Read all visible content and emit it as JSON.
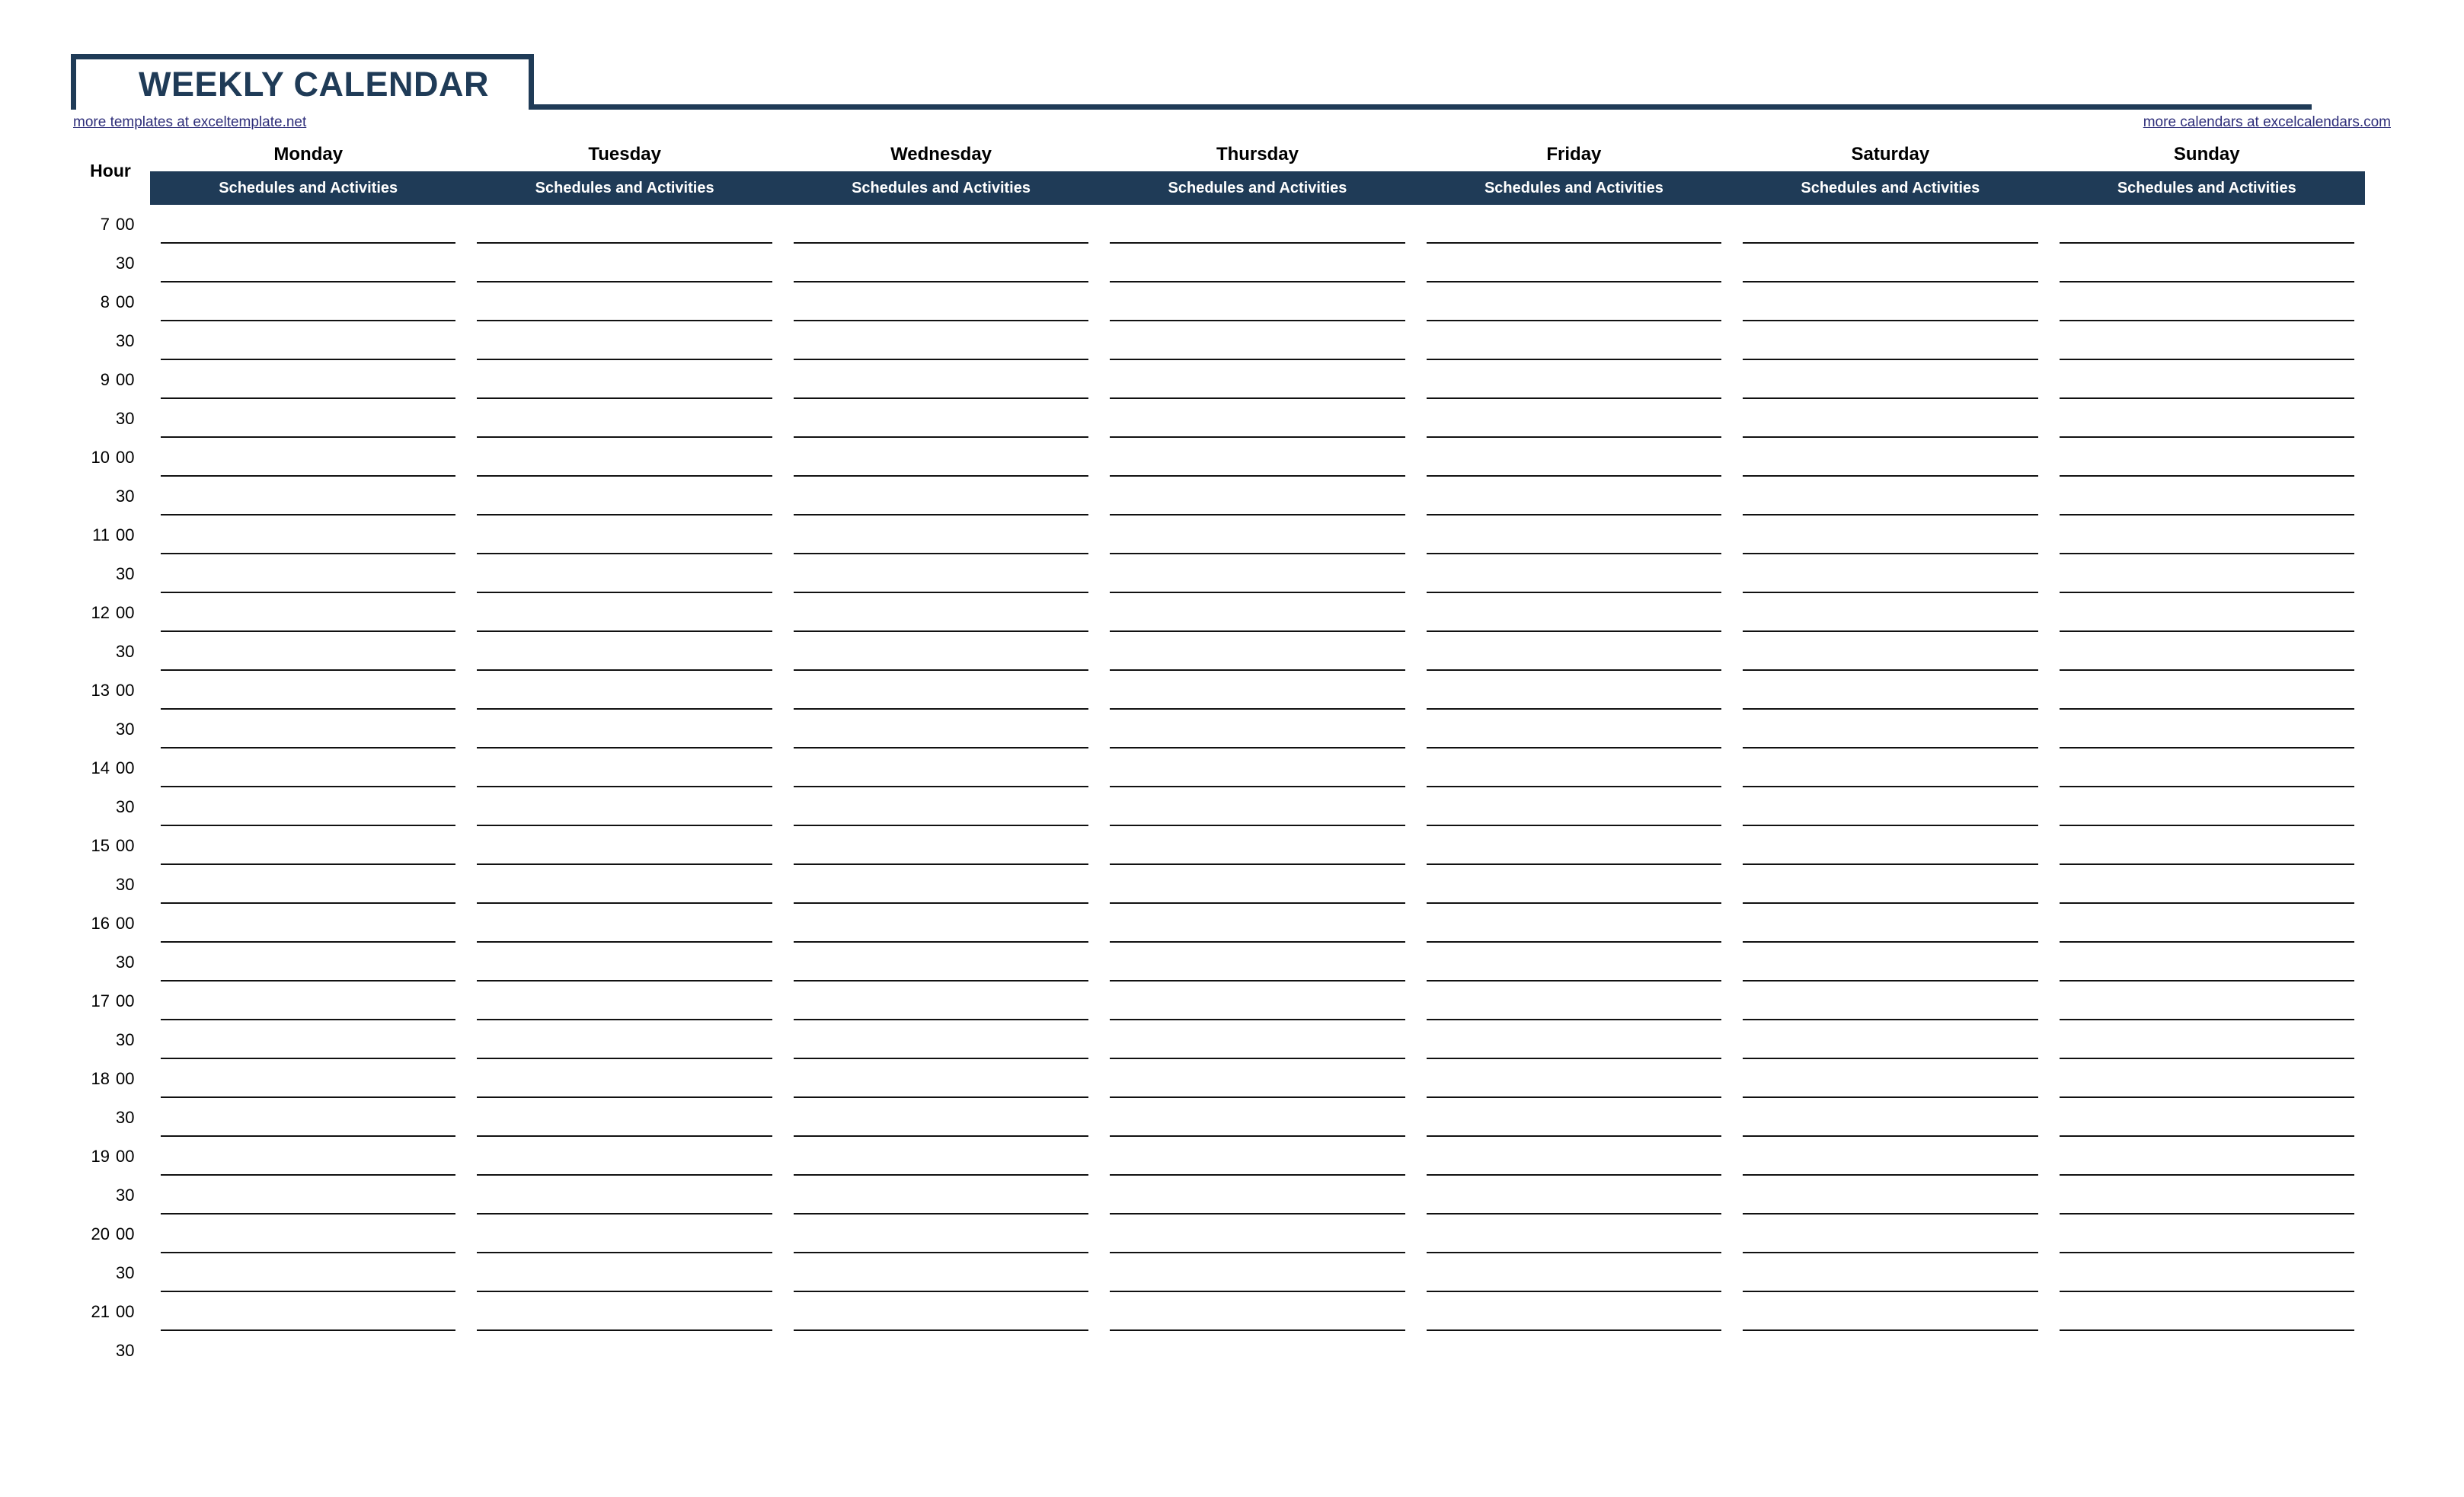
{
  "document": {
    "title": "WEEKLY CALENDAR"
  },
  "links": {
    "left": "more templates at exceltemplate.net",
    "right": "more calendars at excelcalendars.com"
  },
  "table": {
    "hour_column_header": "Hour",
    "subheader_label": "Schedules and Activities",
    "days": [
      "Monday",
      "Tuesday",
      "Wednesday",
      "Thursday",
      "Friday",
      "Saturday",
      "Sunday"
    ],
    "time_slots": [
      {
        "hour": "7",
        "minute": "00"
      },
      {
        "hour": "",
        "minute": "30"
      },
      {
        "hour": "8",
        "minute": "00"
      },
      {
        "hour": "",
        "minute": "30"
      },
      {
        "hour": "9",
        "minute": "00"
      },
      {
        "hour": "",
        "minute": "30"
      },
      {
        "hour": "10",
        "minute": "00"
      },
      {
        "hour": "",
        "minute": "30"
      },
      {
        "hour": "11",
        "minute": "00"
      },
      {
        "hour": "",
        "minute": "30"
      },
      {
        "hour": "12",
        "minute": "00"
      },
      {
        "hour": "",
        "minute": "30"
      },
      {
        "hour": "13",
        "minute": "00"
      },
      {
        "hour": "",
        "minute": "30"
      },
      {
        "hour": "14",
        "minute": "00"
      },
      {
        "hour": "",
        "minute": "30"
      },
      {
        "hour": "15",
        "minute": "00"
      },
      {
        "hour": "",
        "minute": "30"
      },
      {
        "hour": "16",
        "minute": "00"
      },
      {
        "hour": "",
        "minute": "30"
      },
      {
        "hour": "17",
        "minute": "00"
      },
      {
        "hour": "",
        "minute": "30"
      },
      {
        "hour": "18",
        "minute": "00"
      },
      {
        "hour": "",
        "minute": "30"
      },
      {
        "hour": "19",
        "minute": "00"
      },
      {
        "hour": "",
        "minute": "30"
      },
      {
        "hour": "20",
        "minute": "00"
      },
      {
        "hour": "",
        "minute": "30"
      },
      {
        "hour": "21",
        "minute": "00"
      },
      {
        "hour": "",
        "minute": "30"
      }
    ],
    "entries": [
      [
        "",
        "",
        "",
        "",
        "",
        "",
        ""
      ],
      [
        "",
        "",
        "",
        "",
        "",
        "",
        ""
      ],
      [
        "",
        "",
        "",
        "",
        "",
        "",
        ""
      ],
      [
        "",
        "",
        "",
        "",
        "",
        "",
        ""
      ],
      [
        "",
        "",
        "",
        "",
        "",
        "",
        ""
      ],
      [
        "",
        "",
        "",
        "",
        "",
        "",
        ""
      ],
      [
        "",
        "",
        "",
        "",
        "",
        "",
        ""
      ],
      [
        "",
        "",
        "",
        "",
        "",
        "",
        ""
      ],
      [
        "",
        "",
        "",
        "",
        "",
        "",
        ""
      ],
      [
        "",
        "",
        "",
        "",
        "",
        "",
        ""
      ],
      [
        "",
        "",
        "",
        "",
        "",
        "",
        ""
      ],
      [
        "",
        "",
        "",
        "",
        "",
        "",
        ""
      ],
      [
        "",
        "",
        "",
        "",
        "",
        "",
        ""
      ],
      [
        "",
        "",
        "",
        "",
        "",
        "",
        ""
      ],
      [
        "",
        "",
        "",
        "",
        "",
        "",
        ""
      ],
      [
        "",
        "",
        "",
        "",
        "",
        "",
        ""
      ],
      [
        "",
        "",
        "",
        "",
        "",
        "",
        ""
      ],
      [
        "",
        "",
        "",
        "",
        "",
        "",
        ""
      ],
      [
        "",
        "",
        "",
        "",
        "",
        "",
        ""
      ],
      [
        "",
        "",
        "",
        "",
        "",
        "",
        ""
      ],
      [
        "",
        "",
        "",
        "",
        "",
        "",
        ""
      ],
      [
        "",
        "",
        "",
        "",
        "",
        "",
        ""
      ],
      [
        "",
        "",
        "",
        "",
        "",
        "",
        ""
      ],
      [
        "",
        "",
        "",
        "",
        "",
        "",
        ""
      ],
      [
        "",
        "",
        "",
        "",
        "",
        "",
        ""
      ],
      [
        "",
        "",
        "",
        "",
        "",
        "",
        ""
      ],
      [
        "",
        "",
        "",
        "",
        "",
        "",
        ""
      ],
      [
        "",
        "",
        "",
        "",
        "",
        "",
        ""
      ],
      [
        "",
        "",
        "",
        "",
        "",
        "",
        ""
      ],
      [
        "",
        "",
        "",
        "",
        "",
        "",
        ""
      ]
    ]
  },
  "colors": {
    "accent_navy": "#1F3B57",
    "link_color": "#2E2E7A",
    "grid_black": "#000000",
    "page_background": "#FFFFFF"
  }
}
